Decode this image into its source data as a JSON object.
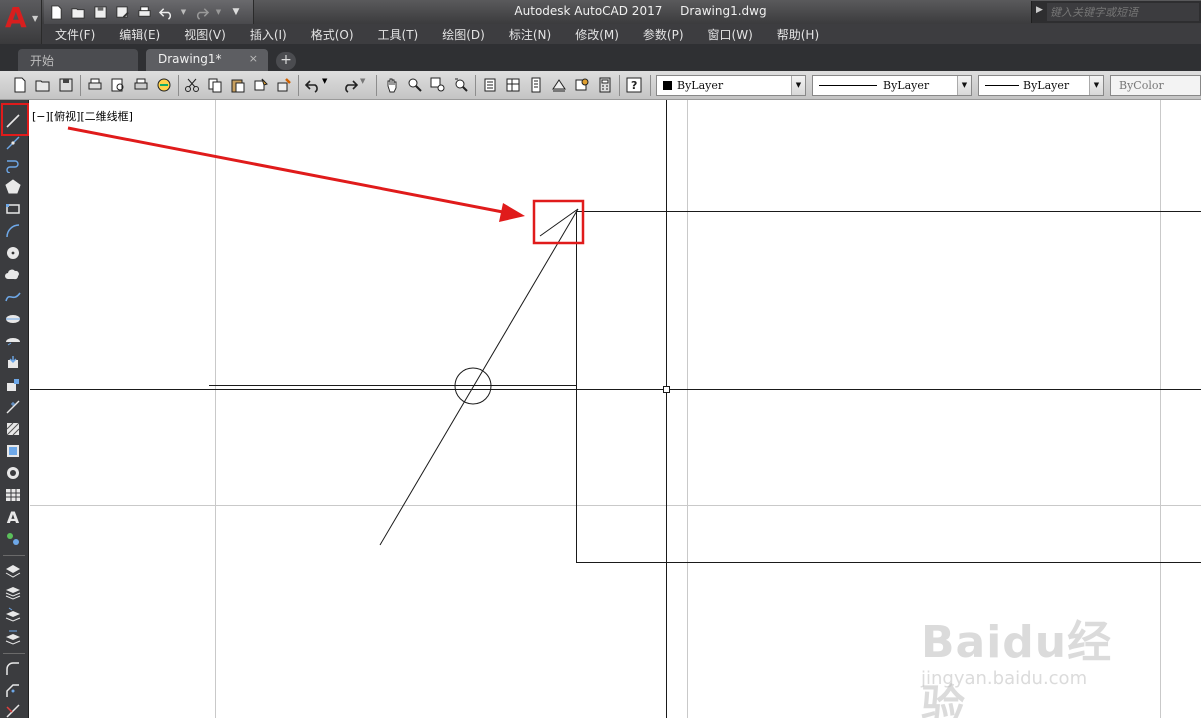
{
  "titlebar": {
    "app_name": "Autodesk AutoCAD 2017",
    "file_name": "Drawing1.dwg",
    "logo_letter": "A",
    "search_placeholder": "键入关键字或短语"
  },
  "menu": {
    "items": [
      "文件(F)",
      "编辑(E)",
      "视图(V)",
      "插入(I)",
      "格式(O)",
      "工具(T)",
      "绘图(D)",
      "标注(N)",
      "修改(M)",
      "参数(P)",
      "窗口(W)",
      "帮助(H)"
    ]
  },
  "tabs": {
    "start_label": "开始",
    "drawing_label": "Drawing1*",
    "close_glyph": "×",
    "new_glyph": "+"
  },
  "properties": {
    "color": "ByLayer",
    "linetype": "ByLayer",
    "lineweight": "ByLayer",
    "plotstyle": "ByColor"
  },
  "canvas": {
    "viewport_label": "[−][俯视][二维线框]"
  },
  "watermark": {
    "brand": "Baidu经验",
    "url": "jingyan.baidu.com"
  },
  "colors": {
    "annotation_red": "#e01b1b",
    "accent_logo": "#d81e1e",
    "grid_line": "#c9c9c9"
  }
}
